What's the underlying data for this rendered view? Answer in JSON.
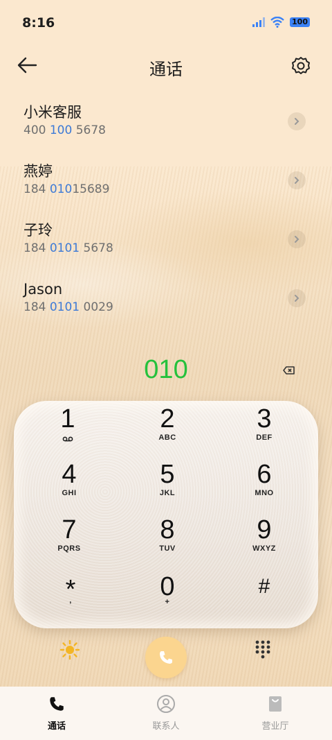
{
  "status_bar": {
    "time": "8:16",
    "battery": "100"
  },
  "header": {
    "title": "通话"
  },
  "contacts": [
    {
      "name": "小米客服",
      "number_parts": [
        "400 ",
        "100",
        " 5678"
      ]
    },
    {
      "name": "燕婷",
      "number_parts": [
        "184 ",
        "010",
        "15689"
      ]
    },
    {
      "name": "子玲",
      "number_parts": [
        "184 ",
        "0101",
        " 5678"
      ]
    },
    {
      "name": "Jason",
      "number_parts": [
        "184 ",
        "0101",
        " 0029"
      ]
    }
  ],
  "dialer": {
    "input": "010",
    "keys": [
      {
        "digit": "1",
        "letters": ""
      },
      {
        "digit": "2",
        "letters": "ABC"
      },
      {
        "digit": "3",
        "letters": "DEF"
      },
      {
        "digit": "4",
        "letters": "GHI"
      },
      {
        "digit": "5",
        "letters": "JKL"
      },
      {
        "digit": "6",
        "letters": "MNO"
      },
      {
        "digit": "7",
        "letters": "PQRS"
      },
      {
        "digit": "8",
        "letters": "TUV"
      },
      {
        "digit": "9",
        "letters": "WXYZ"
      },
      {
        "digit": "*",
        "letters": ","
      },
      {
        "digit": "0",
        "letters": "+"
      },
      {
        "digit": "#",
        "letters": ""
      }
    ]
  },
  "tabs": [
    {
      "label": "通话",
      "icon": "phone-icon",
      "active": true
    },
    {
      "label": "联系人",
      "icon": "person-icon",
      "active": false
    },
    {
      "label": "营业厅",
      "icon": "bag-icon",
      "active": false
    }
  ],
  "colors": {
    "accent_green": "#25c13c",
    "highlight_blue": "#3d7ad6",
    "call_button": "#fbd58f"
  }
}
